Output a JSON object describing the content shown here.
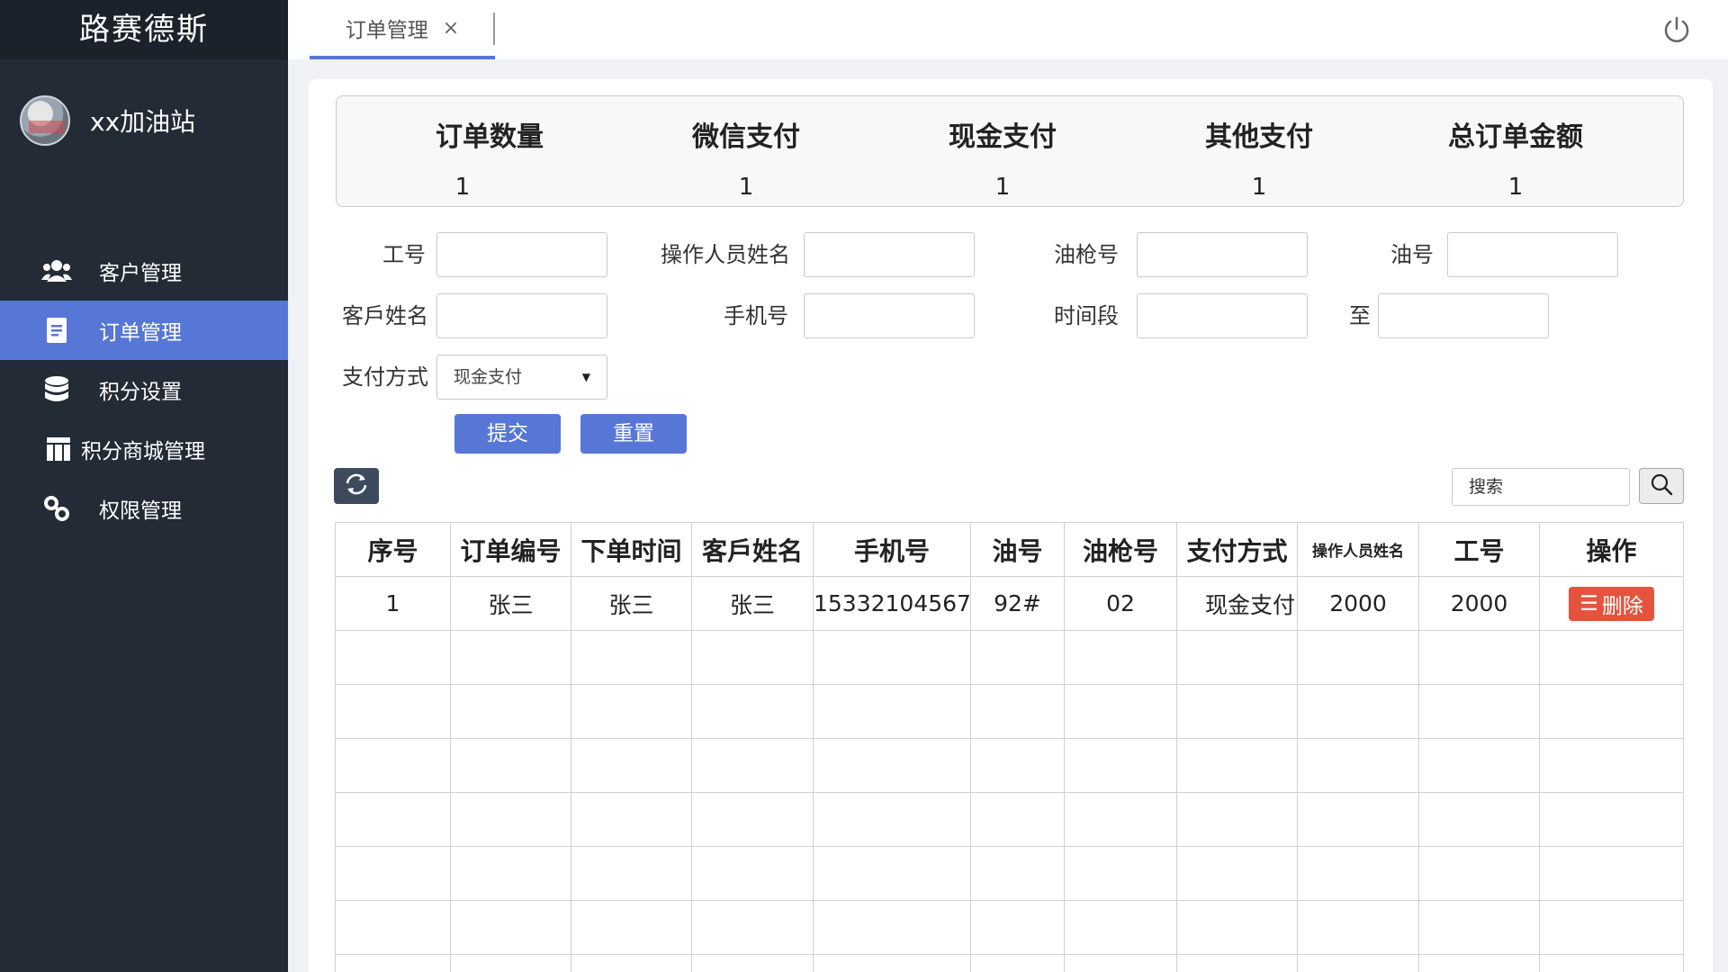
{
  "sidebar": {
    "brand": "路赛德斯",
    "user_name": "xx加油站",
    "items": [
      {
        "label": "客户管理"
      },
      {
        "label": "订单管理"
      },
      {
        "label": "积分设置"
      },
      {
        "label": "积分商城管理"
      },
      {
        "label": "权限管理"
      }
    ]
  },
  "header": {
    "tab_label": "订单管理",
    "tab_close": "×"
  },
  "summary": [
    {
      "label": "订单数量",
      "value": "1"
    },
    {
      "label": "微信支付",
      "value": "1"
    },
    {
      "label": "现金支付",
      "value": "1"
    },
    {
      "label": "其他支付",
      "value": "1"
    },
    {
      "label": "总订单金额",
      "value": "1"
    }
  ],
  "filters": {
    "worker_id_label": "工号",
    "operator_name_label": "操作人员姓名",
    "nozzle_label": "油枪号",
    "oil_no_label": "油号",
    "customer_name_label": "客戶姓名",
    "phone_label": "手机号",
    "time_range_label": "时间段",
    "to_label": "至",
    "payment_label": "支付方式",
    "payment_selected": "现金支付",
    "submit": "提交",
    "reset": "重置"
  },
  "toolbar": {
    "search_placeholder": "搜索"
  },
  "table": {
    "headers": [
      "序号",
      "订单编号",
      "下单时间",
      "客戶姓名",
      "手机号",
      "油号",
      "油枪号",
      "支付方式",
      "操作人员姓名",
      "工号",
      "操作"
    ],
    "rows": [
      {
        "seq": "1",
        "order_no": "张三",
        "time": "张三",
        "customer": "张三",
        "phone": "15332104567",
        "oil": "92#",
        "nozzle": "02",
        "payment": "现金支付",
        "operator": "2000",
        "worker_id": "2000",
        "action": "删除"
      }
    ]
  },
  "colors": {
    "sidebar_bg": "#232b36",
    "accent": "#5677d6",
    "danger": "#e5533f"
  }
}
